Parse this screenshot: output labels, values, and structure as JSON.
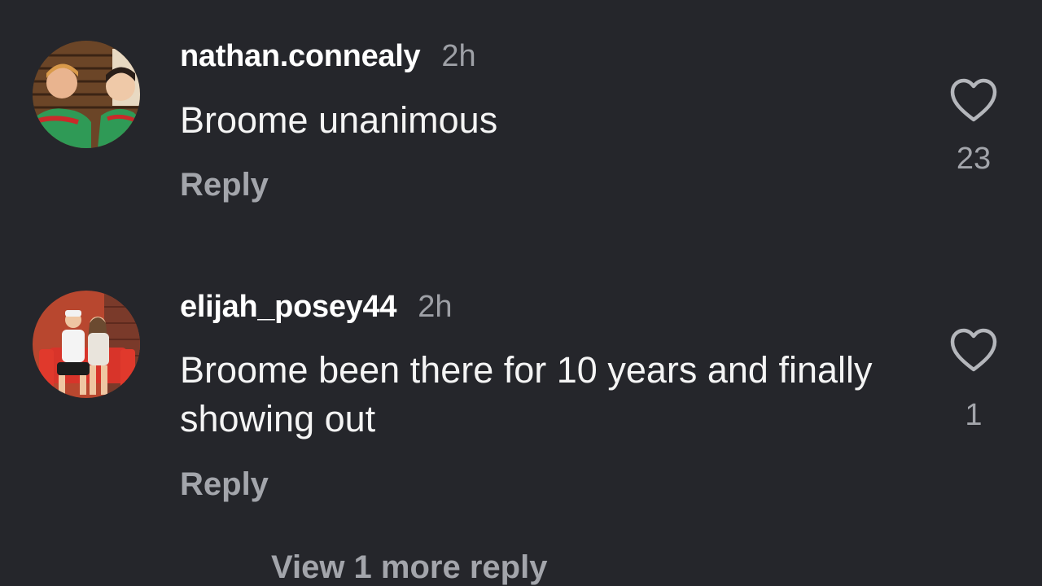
{
  "comments": [
    {
      "username": "nathan.connealy",
      "time": "2h",
      "text": "Broome unanimous",
      "reply_label": "Reply",
      "like_count": "23",
      "like_icon": "heart-outline-icon"
    },
    {
      "username": "elijah_posey44",
      "time": "2h",
      "text": "Broome been there for 10 years and finally showing out",
      "reply_label": "Reply",
      "like_count": "1",
      "like_icon": "heart-outline-icon"
    }
  ],
  "view_more_label": "View 1 more reply",
  "colors": {
    "background": "#25262b",
    "primary_text": "#ffffff",
    "secondary_text": "#a3a5ab"
  }
}
